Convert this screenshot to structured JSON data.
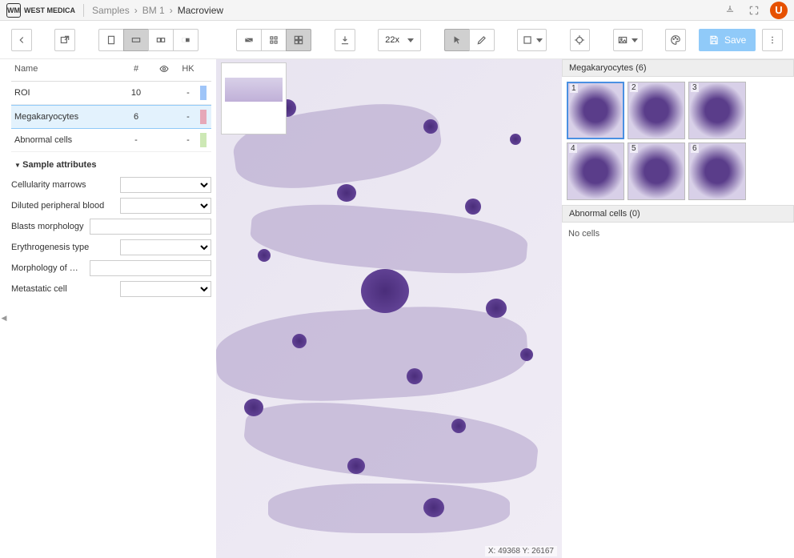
{
  "header": {
    "logo_text": "WEST MEDICA",
    "logo_mark": "WM",
    "breadcrumb": [
      "Samples",
      "BM 1",
      "Macroview"
    ],
    "user_initial": "U"
  },
  "toolbar": {
    "zoom": "22x",
    "save_label": "Save"
  },
  "classes_table": {
    "headers": {
      "name": "Name",
      "count": "#",
      "visible": "👁",
      "hotkey": "HK"
    },
    "rows": [
      {
        "name": "ROI",
        "count": "10",
        "hk": "-",
        "color": "#9fc5f8",
        "selected": false
      },
      {
        "name": "Megakaryocytes",
        "count": "6",
        "hk": "-",
        "color": "#e6a8b8",
        "selected": true
      },
      {
        "name": "Abnormal cells",
        "count": "-",
        "hk": "-",
        "color": "#cde8b5",
        "selected": false
      }
    ]
  },
  "attributes": {
    "section_title": "Sample attributes",
    "rows": [
      {
        "label": "Cellularity marrows",
        "type": "select",
        "value": ""
      },
      {
        "label": "Diluted peripheral blood",
        "type": "select",
        "value": ""
      },
      {
        "label": "Blasts morphology",
        "type": "text",
        "value": ""
      },
      {
        "label": "Erythrogenesis type",
        "type": "select",
        "value": ""
      },
      {
        "label": "Morphology of megakaryocyt...",
        "type": "text",
        "value": ""
      },
      {
        "label": "Metastatic cell",
        "type": "select",
        "value": ""
      }
    ]
  },
  "viewer": {
    "coords": "X: 49368 Y: 26167"
  },
  "right_panel": {
    "group1_title": "Megakaryocytes (6)",
    "group1_thumbs": [
      1,
      2,
      3,
      4,
      5,
      6
    ],
    "group2_title": "Abnormal cells (0)",
    "group2_empty": "No cells"
  }
}
